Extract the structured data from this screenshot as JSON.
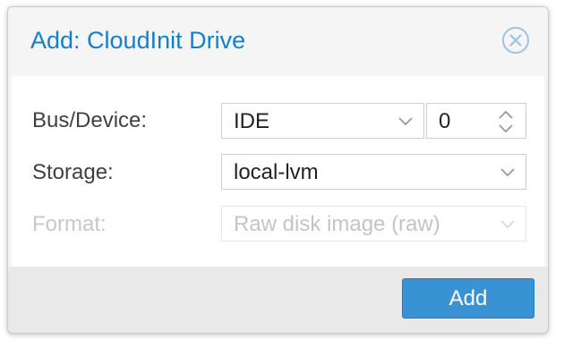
{
  "dialog": {
    "title": "Add: CloudInit Drive",
    "close_icon": "close-circle-icon"
  },
  "form": {
    "bus_device": {
      "label": "Bus/Device:",
      "bus_value": "IDE",
      "device_value": "0"
    },
    "storage": {
      "label": "Storage:",
      "value": "local-lvm"
    },
    "format": {
      "label": "Format:",
      "value": "Raw disk image (raw)",
      "disabled": true
    }
  },
  "footer": {
    "add_label": "Add"
  },
  "colors": {
    "accent": "#157fcc",
    "button_bg": "#3892d4",
    "footer_bg": "#e9e9e9"
  }
}
